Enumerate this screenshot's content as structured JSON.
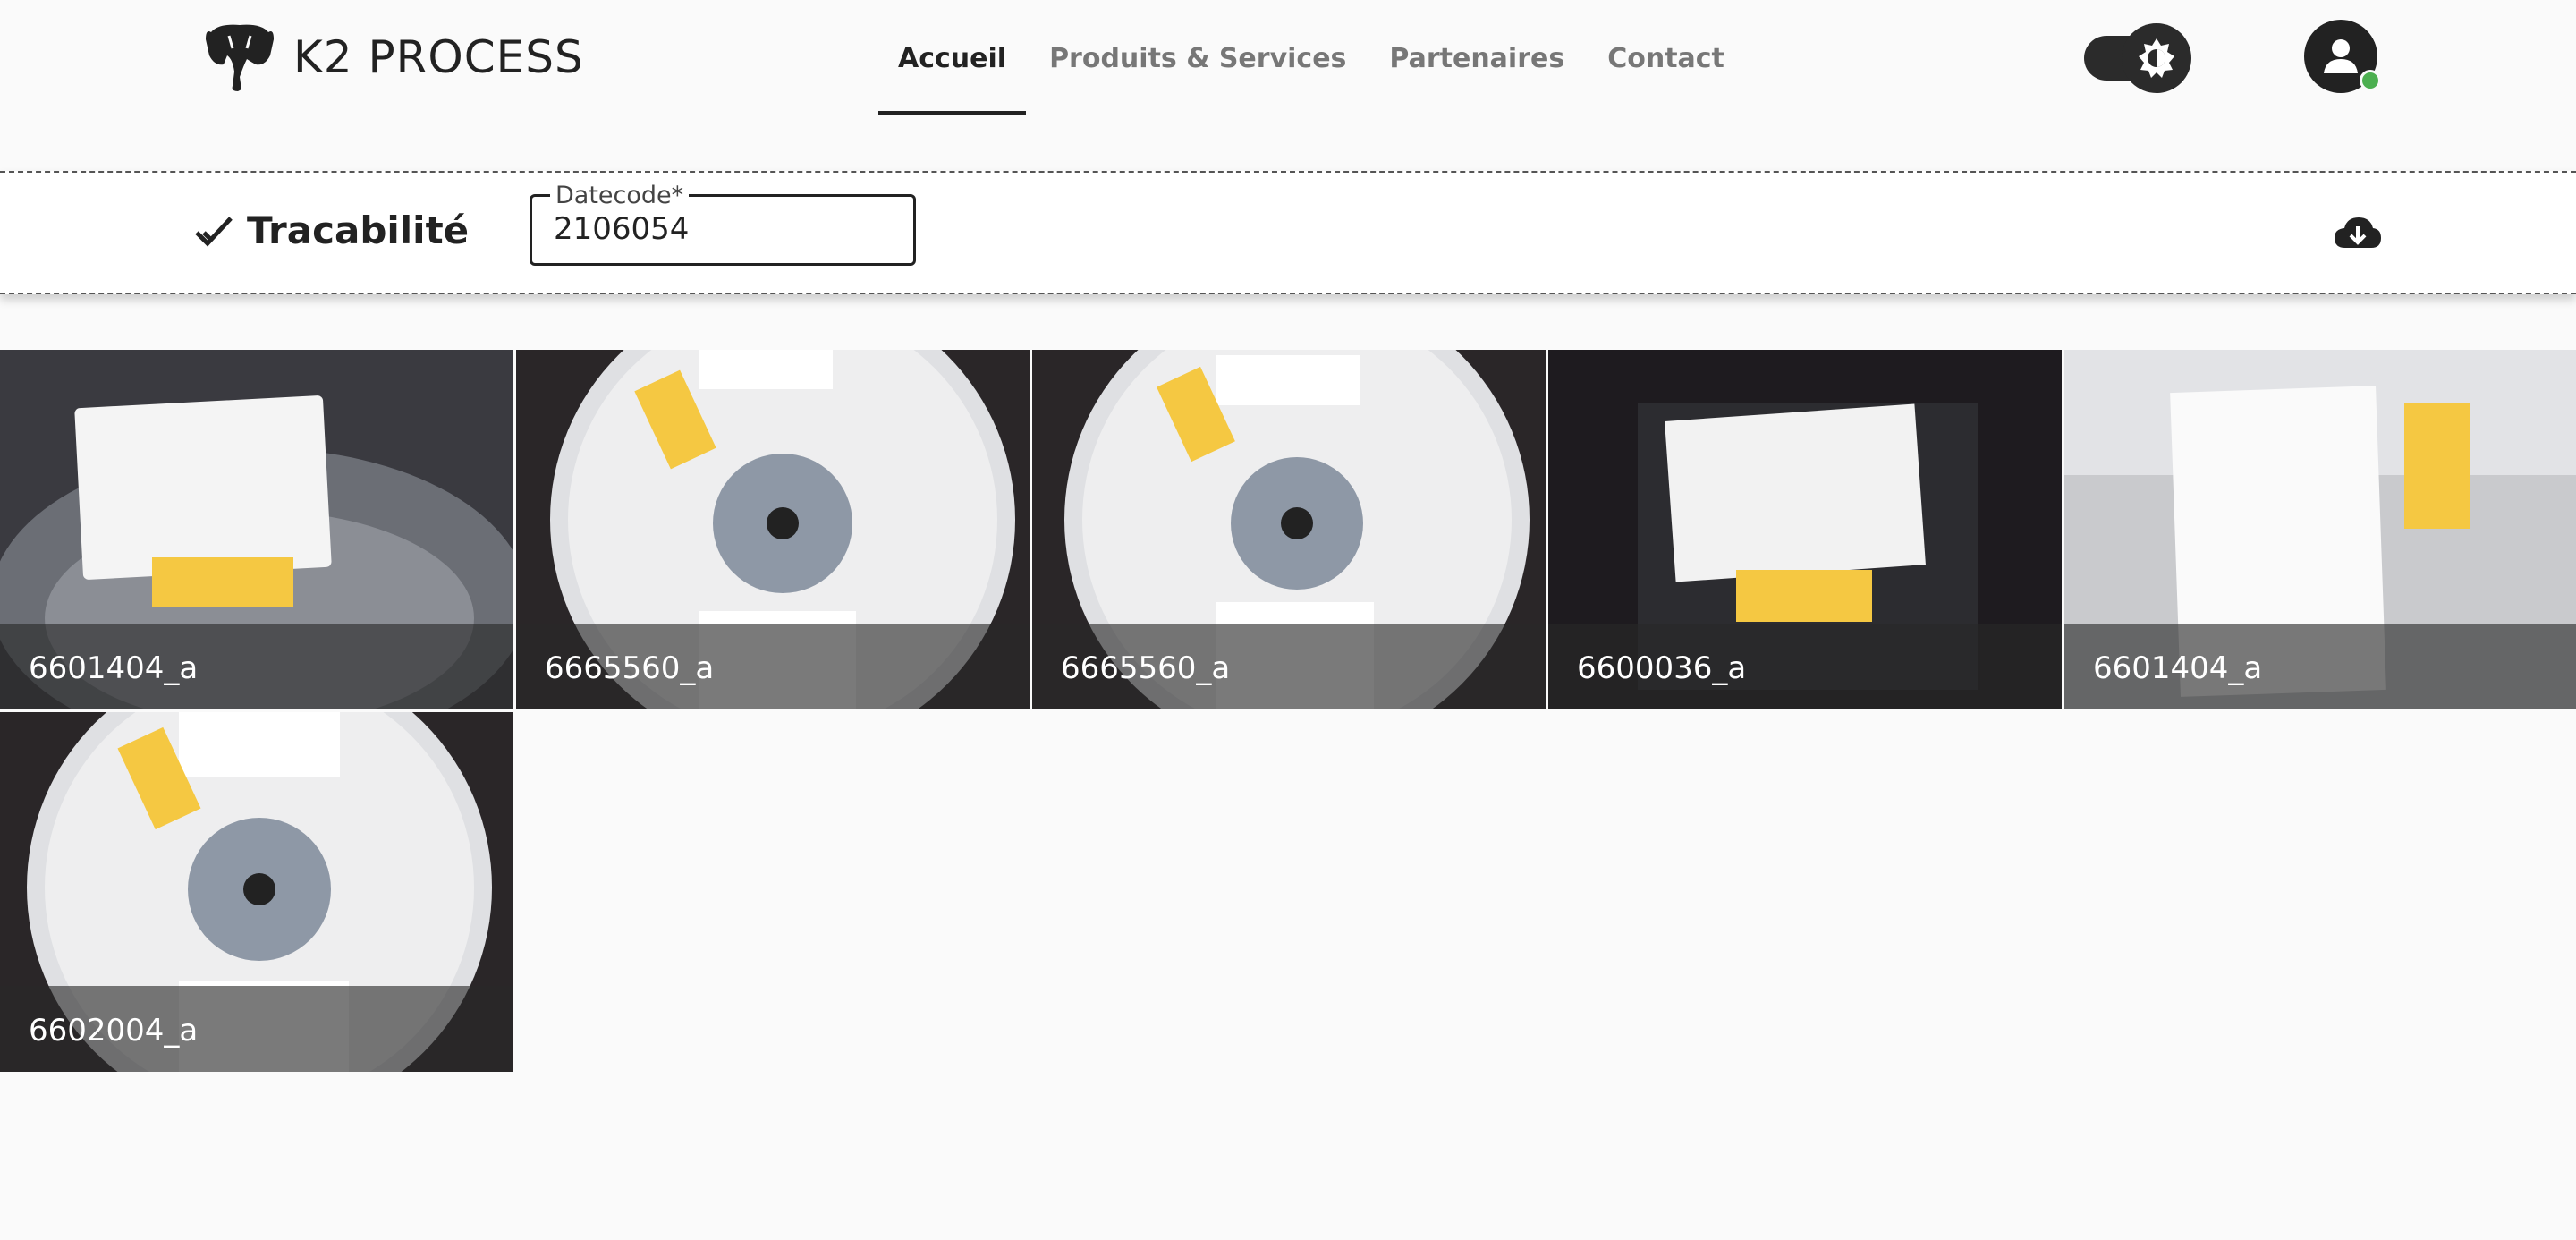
{
  "header": {
    "brand": "K2 PROCESS",
    "nav": [
      "Accueil",
      "Produits & Services",
      "Partenaires",
      "Contact"
    ],
    "active_nav": "Accueil"
  },
  "toolbar": {
    "title": "Tracabilité",
    "datecode_label": "Datecode*",
    "datecode_value": "2106054"
  },
  "photos": [
    {
      "caption": "6601404_a"
    },
    {
      "caption": "6665560_a"
    },
    {
      "caption": "6665560_a"
    },
    {
      "caption": "6600036_a"
    },
    {
      "caption": "6601404_a"
    },
    {
      "caption": "6602004_a"
    }
  ],
  "colors": {
    "accent": "#222222",
    "online": "#4caf50",
    "label_yellow": "#f5c842"
  }
}
